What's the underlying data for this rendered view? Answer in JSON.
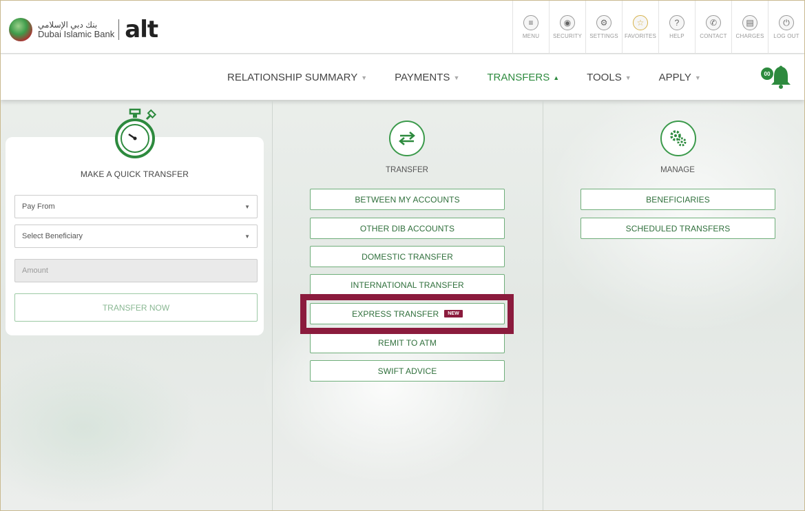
{
  "header": {
    "bank_name_ar": "بنك دبي الإسلامي",
    "bank_name_en": "Dubai Islamic Bank",
    "brand": "alt",
    "icons": [
      {
        "name": "menu-icon",
        "label": "MENU",
        "glyph": "≡"
      },
      {
        "name": "security-icon",
        "label": "SECURITY",
        "glyph": "◉"
      },
      {
        "name": "settings-icon",
        "label": "SETTINGS",
        "glyph": "⚙"
      },
      {
        "name": "favorites-icon",
        "label": "FAVORITES",
        "glyph": "☆"
      },
      {
        "name": "help-icon",
        "label": "HELP",
        "glyph": "?"
      },
      {
        "name": "contact-icon",
        "label": "CONTACT",
        "glyph": "✆"
      },
      {
        "name": "charges-icon",
        "label": "CHARGES",
        "glyph": "▤"
      },
      {
        "name": "logout-icon",
        "label": "LOG OUT",
        "glyph": "⏻"
      }
    ]
  },
  "nav": {
    "items": [
      "RELATIONSHIP SUMMARY",
      "PAYMENTS",
      "TRANSFERS",
      "TOOLS",
      "APPLY"
    ],
    "active": "TRANSFERS",
    "notifications": "00"
  },
  "quick_transfer": {
    "title": "MAKE A QUICK TRANSFER",
    "pay_from": "Pay From",
    "beneficiary": "Select Beneficiary",
    "amount_placeholder": "Amount",
    "submit": "TRANSFER NOW"
  },
  "transfer": {
    "title": "TRANSFER",
    "options": [
      "BETWEEN MY ACCOUNTS",
      "OTHER DIB ACCOUNTS",
      "DOMESTIC TRANSFER",
      "INTERNATIONAL TRANSFER",
      "EXPRESS TRANSFER",
      "REMIT TO ATM",
      "SWIFT ADVICE"
    ],
    "new_badge": "NEW"
  },
  "manage": {
    "title": "MANAGE",
    "options": [
      "BENEFICIARIES",
      "SCHEDULED TRANSFERS"
    ]
  },
  "colors": {
    "accent": "#2d8a3e",
    "highlight": "#8b1b3d"
  }
}
